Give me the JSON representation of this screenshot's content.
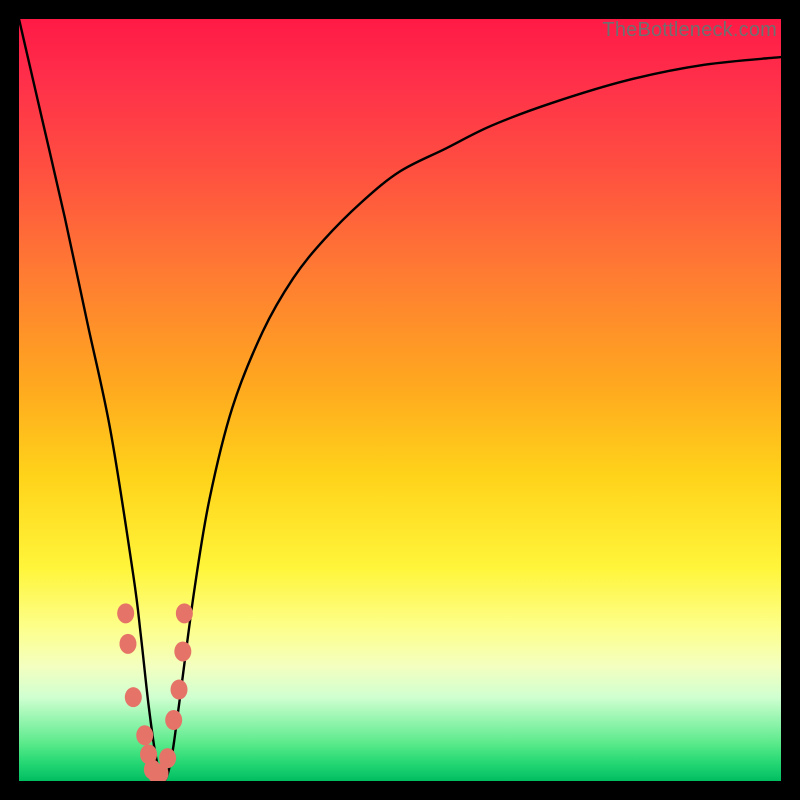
{
  "attribution": "TheBottleneck.com",
  "chart_data": {
    "type": "line",
    "title": "",
    "xlabel": "",
    "ylabel": "",
    "xlim": [
      0,
      100
    ],
    "ylim": [
      0,
      100
    ],
    "grid": false,
    "legend": false,
    "annotations": [],
    "series": [
      {
        "name": "curve",
        "color": "#000000",
        "x": [
          0,
          3,
          6,
          9,
          12,
          15,
          16,
          17,
          18,
          19,
          20,
          21,
          23,
          25,
          28,
          32,
          36,
          40,
          45,
          50,
          56,
          62,
          70,
          80,
          90,
          100
        ],
        "y": [
          100,
          87,
          74,
          60,
          46,
          27,
          19,
          10,
          3,
          0,
          3,
          10,
          25,
          37,
          49,
          59,
          66,
          71,
          76,
          80,
          83,
          86,
          89,
          92,
          94,
          95
        ]
      },
      {
        "name": "markers",
        "type": "scatter",
        "color": "#e57368",
        "x": [
          14.0,
          14.3,
          15.0,
          16.5,
          17.0,
          17.5,
          18.0,
          18.5,
          19.5,
          20.3,
          21.0,
          21.5,
          21.7
        ],
        "y": [
          22.0,
          18.0,
          11.0,
          6.0,
          3.5,
          1.5,
          1.0,
          1.0,
          3.0,
          8.0,
          12.0,
          17.0,
          22.0
        ]
      }
    ]
  },
  "colors": {
    "curve": "#000000",
    "marker_fill": "#e57368",
    "marker_stroke": "#c24f47"
  }
}
